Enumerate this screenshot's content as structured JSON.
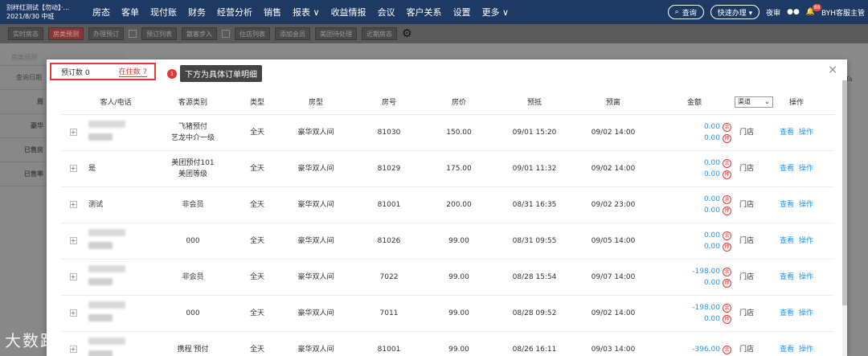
{
  "header": {
    "hotel_name": "别样红测试【勿动】·...",
    "shift": "2021/8/30 中班",
    "menu": [
      "房态",
      "客单",
      "现付账",
      "财务",
      "经营分析",
      "销售",
      "报表 ∨",
      "收益情报",
      "会议",
      "客户关系",
      "设置",
      "更多 ∨"
    ],
    "search_label": "查询",
    "quick_label": "快速办理 ▾",
    "night_audit": "夜审",
    "notif_count": "88",
    "user": "BYH客服主管"
  },
  "toolbar": {
    "buttons": [
      "实时房态",
      "房类预测",
      "办理预订",
      "预订列表",
      "散客步入",
      "住店列表",
      "添加会员",
      "美团待处理",
      "近期房态"
    ]
  },
  "leftpanel": {
    "tabs": [
      "房类预测",
      "房类可用",
      "房型房态"
    ],
    "header": "查询日期",
    "rows": [
      "周",
      "豪华",
      "已售房",
      "已售率"
    ]
  },
  "rightcol": {
    "text": "Ta"
  },
  "modal": {
    "tab_booked": "预订数 0",
    "tab_inhouse": "在住数 7",
    "callout_num": "1",
    "callout_text": "下方为具体订单明细",
    "close": "×",
    "channel_select": "渠道",
    "columns": [
      "客人/电话",
      "客源类别",
      "类型",
      "房型",
      "房号",
      "房价",
      "预抵",
      "预离",
      "金额",
      "",
      "操作"
    ],
    "rows": [
      {
        "guest": "",
        "source": "飞猪预付",
        "source2": "艺龙中介一级",
        "type": "全天",
        "room_type": "豪华双人间",
        "room_no": "81030",
        "price": "150.00",
        "arrive": "09/01 15:20",
        "depart": "09/02 14:00",
        "amt1": "0.00",
        "amt2": "0.00",
        "channel": "门店"
      },
      {
        "guest": "是",
        "source": "美团预付101",
        "source2": "美团等级",
        "type": "全天",
        "room_type": "豪华双人间",
        "room_no": "81029",
        "price": "175.00",
        "arrive": "09/01 11:32",
        "depart": "09/02 14:00",
        "amt1": "0.00",
        "amt2": "0.00",
        "channel": "门店"
      },
      {
        "guest": "测试",
        "source": "非会员",
        "source2": "",
        "type": "全天",
        "room_type": "豪华双人间",
        "room_no": "81001",
        "price": "200.00",
        "arrive": "08/31 16:35",
        "depart": "09/02 23:00",
        "amt1": "0.00",
        "amt2": "0.00",
        "channel": "门店"
      },
      {
        "guest": "",
        "source": "000",
        "source2": "",
        "type": "全天",
        "room_type": "豪华双人间",
        "room_no": "81026",
        "price": "99.00",
        "arrive": "08/31 09:55",
        "depart": "09/05 14:00",
        "amt1": "0.00",
        "amt2": "0.00",
        "channel": "门店"
      },
      {
        "guest": "",
        "source": "非会员",
        "source2": "",
        "type": "全天",
        "room_type": "豪华双人间",
        "room_no": "7022",
        "price": "99.00",
        "arrive": "08/28 15:54",
        "depart": "09/07 14:00",
        "amt1": "-198.00",
        "amt2": "0.00",
        "channel": "门店"
      },
      {
        "guest": "",
        "source": "000",
        "source2": "",
        "type": "全天",
        "room_type": "豪华双人间",
        "room_no": "7011",
        "price": "99.00",
        "arrive": "08/28 09:52",
        "depart": "09/02 14:00",
        "amt1": "-198.00",
        "amt2": "0.00",
        "channel": "门店"
      },
      {
        "guest": "",
        "source": "携程 预付",
        "source2": "",
        "type": "全天",
        "room_type": "豪华双人间",
        "room_no": "81001",
        "price": "99.00",
        "arrive": "08/26 16:11",
        "depart": "09/03 14:00",
        "amt1": "-396.00",
        "amt2": "",
        "channel": "门店"
      }
    ],
    "circ_a": "余",
    "circ_b": "押",
    "action_view": "查看",
    "action_op": "操作"
  },
  "watermark": "大数跨境"
}
